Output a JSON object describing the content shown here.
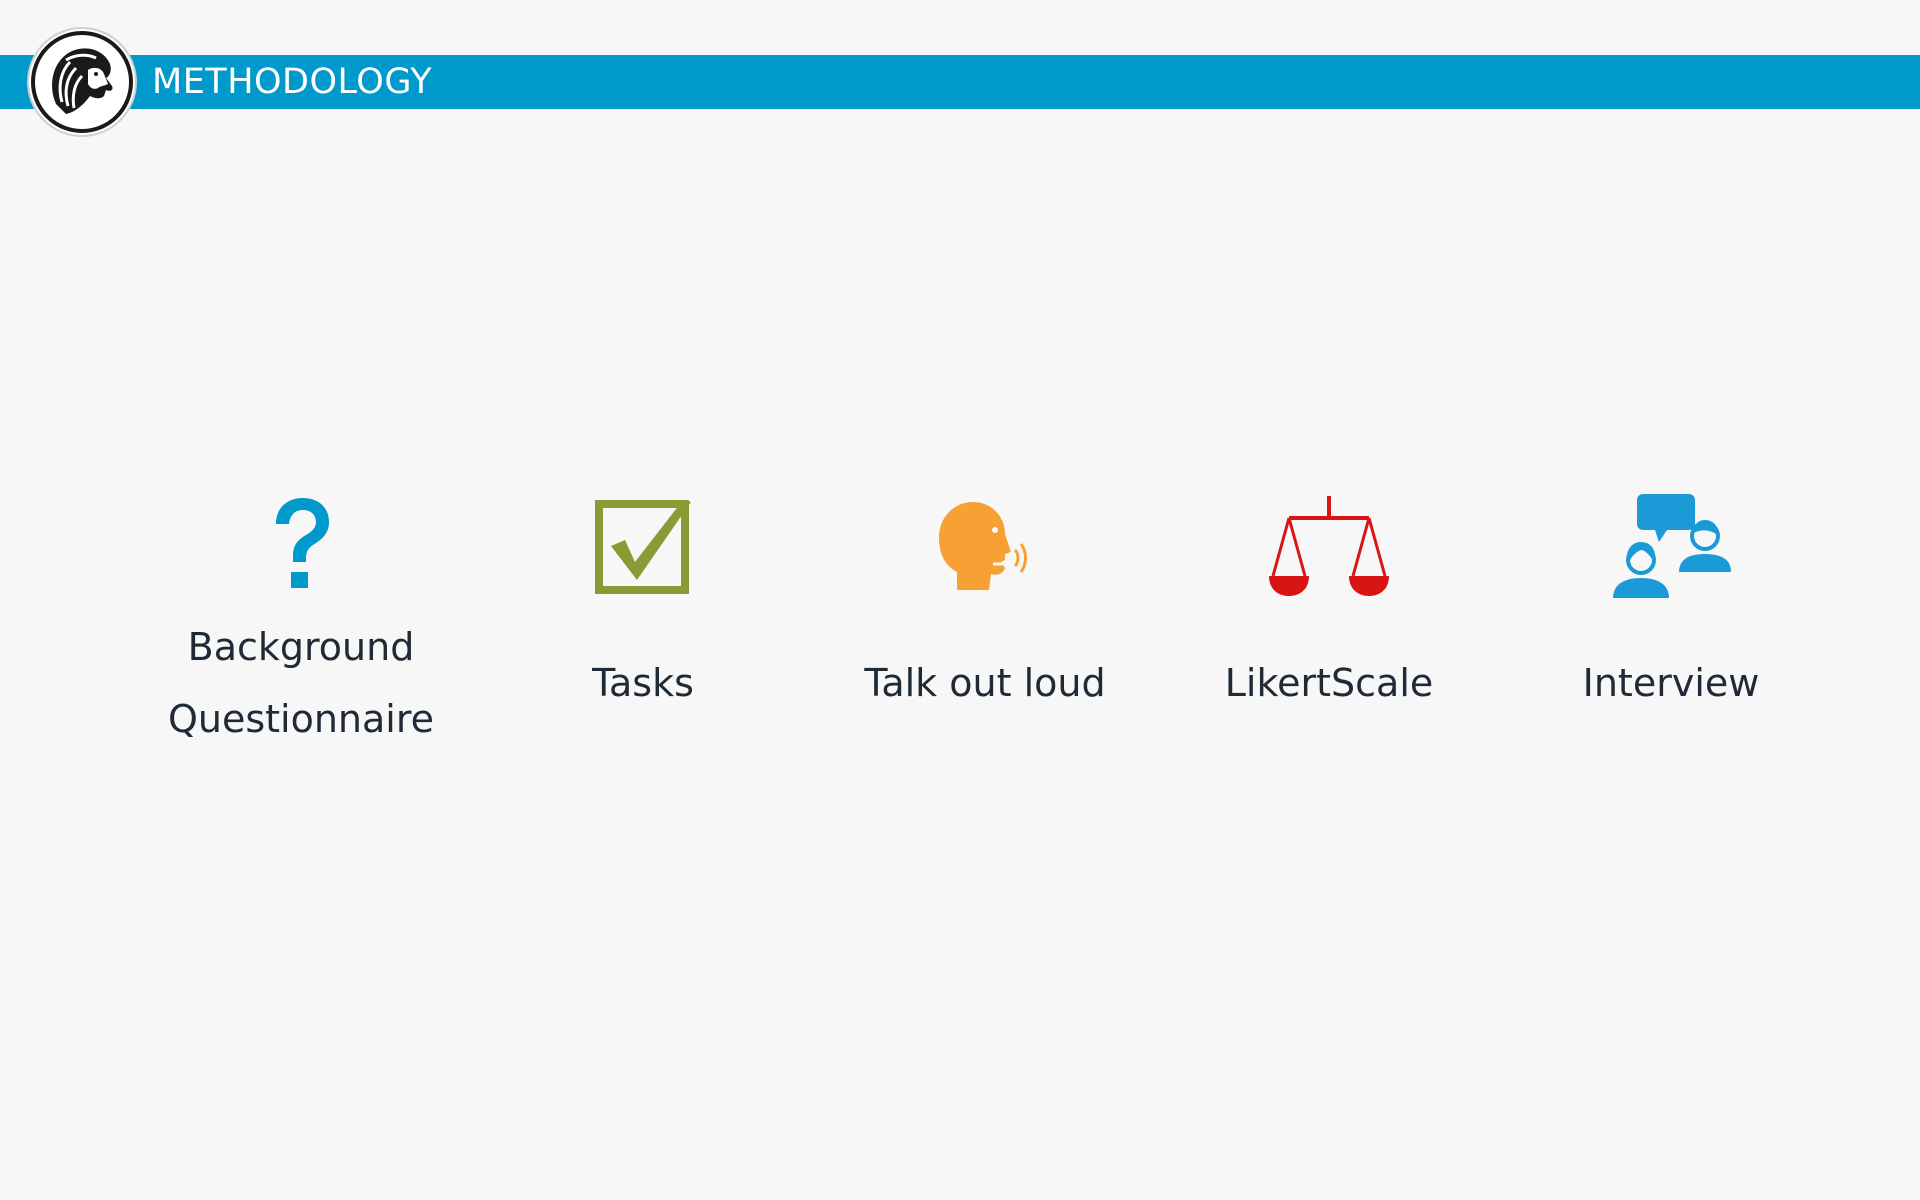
{
  "header": {
    "title": "METHODOLOGY",
    "bar_color": "#0099cc",
    "logo_icon": "lion-logo-icon"
  },
  "items": [
    {
      "label": "Background\nQuestionnaire",
      "icon": "question-mark-icon",
      "color": "#0099cc"
    },
    {
      "label": "Tasks",
      "icon": "checkbox-checked-icon",
      "color": "#8a9a35"
    },
    {
      "label": "Talk out loud",
      "icon": "speaking-head-icon",
      "color": "#f7a033"
    },
    {
      "label": "LikertScale",
      "icon": "balance-scale-icon",
      "color": "#d91414"
    },
    {
      "label": "Interview",
      "icon": "interview-people-icon",
      "color": "#1a9bd7"
    }
  ]
}
